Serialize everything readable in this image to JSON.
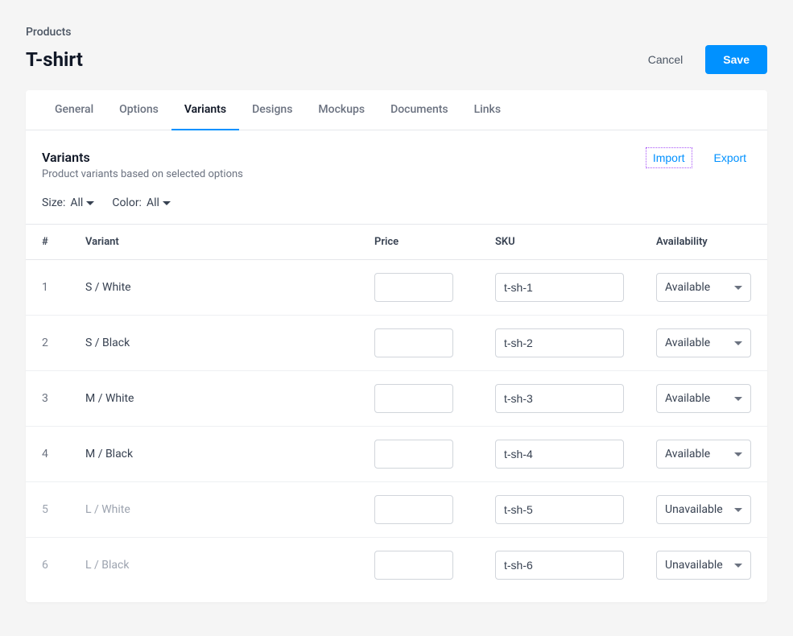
{
  "breadcrumb": "Products",
  "title": "T-shirt",
  "buttons": {
    "cancel": "Cancel",
    "save": "Save"
  },
  "tabs": [
    {
      "label": "General",
      "active": false
    },
    {
      "label": "Options",
      "active": false
    },
    {
      "label": "Variants",
      "active": true
    },
    {
      "label": "Designs",
      "active": false
    },
    {
      "label": "Mockups",
      "active": false
    },
    {
      "label": "Documents",
      "active": false
    },
    {
      "label": "Links",
      "active": false
    }
  ],
  "section": {
    "title": "Variants",
    "subtitle": "Product variants based on selected options",
    "import": "Import",
    "export": "Export"
  },
  "filters": {
    "size_label": "Size:",
    "size_value": "All",
    "color_label": "Color:",
    "color_value": "All"
  },
  "columns": {
    "num": "#",
    "variant": "Variant",
    "price": "Price",
    "sku": "SKU",
    "availability": "Availability"
  },
  "rows": [
    {
      "idx": "1",
      "name": "S / White",
      "price": "",
      "sku": "t-sh-1",
      "availability": "Available"
    },
    {
      "idx": "2",
      "name": "S / Black",
      "price": "",
      "sku": "t-sh-2",
      "availability": "Available"
    },
    {
      "idx": "3",
      "name": "M / White",
      "price": "",
      "sku": "t-sh-3",
      "availability": "Available"
    },
    {
      "idx": "4",
      "name": "M / Black",
      "price": "",
      "sku": "t-sh-4",
      "availability": "Available"
    },
    {
      "idx": "5",
      "name": "L / White",
      "price": "",
      "sku": "t-sh-5",
      "availability": "Unavailable"
    },
    {
      "idx": "6",
      "name": "L / Black",
      "price": "",
      "sku": "t-sh-6",
      "availability": "Unavailable"
    }
  ]
}
